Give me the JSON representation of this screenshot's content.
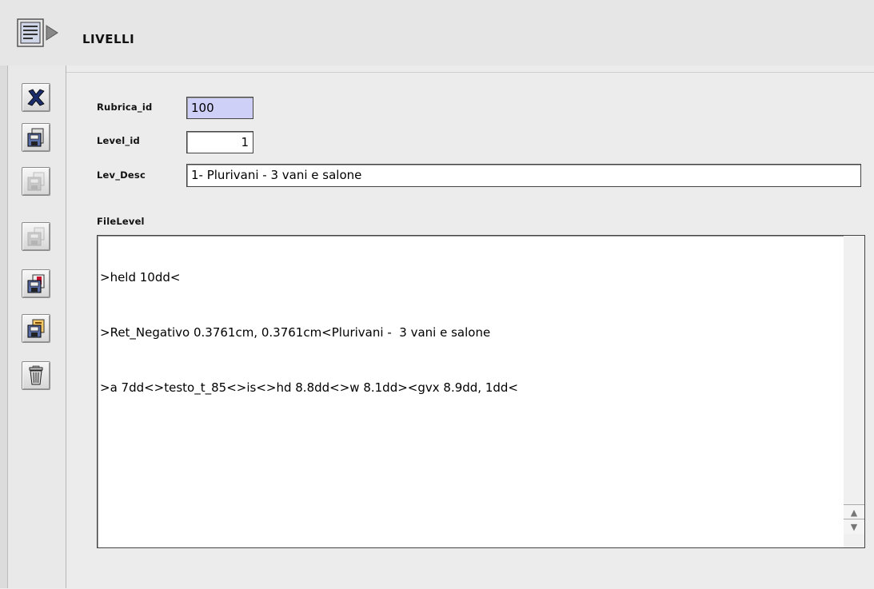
{
  "window": {
    "title": "LIVELLI"
  },
  "toolbar": {
    "items": [
      {
        "icon": "close-x-icon",
        "enabled": true
      },
      {
        "icon": "save-icon",
        "enabled": true
      },
      {
        "icon": "save-all-icon",
        "enabled": false
      },
      {
        "icon": "copy-icon",
        "enabled": false
      },
      {
        "icon": "export-icon",
        "enabled": true
      },
      {
        "icon": "import-icon",
        "enabled": true
      },
      {
        "icon": "trash-icon",
        "enabled": true
      }
    ]
  },
  "form": {
    "rubrica_id": {
      "label": "Rubrica_id",
      "value": "100"
    },
    "level_id": {
      "label": "Level_id",
      "value": "1"
    },
    "lev_desc": {
      "label": "Lev_Desc",
      "value": "1- Plurivani - 3 vani e salone"
    },
    "filelevel": {
      "label": "FileLevel",
      "lines": [
        ">held 10dd<",
        ">Ret_Negativo 0.3761cm, 0.3761cm<Plurivani -  3 vani e salone",
        ">a 7dd<>testo_t_85<>is<>hd 8.8dd<>w 8.1dd><gvx 8.9dd, 1dd<"
      ]
    }
  },
  "colors": {
    "selected_field": "#cfd0f7",
    "window_bg": "#ececec"
  }
}
